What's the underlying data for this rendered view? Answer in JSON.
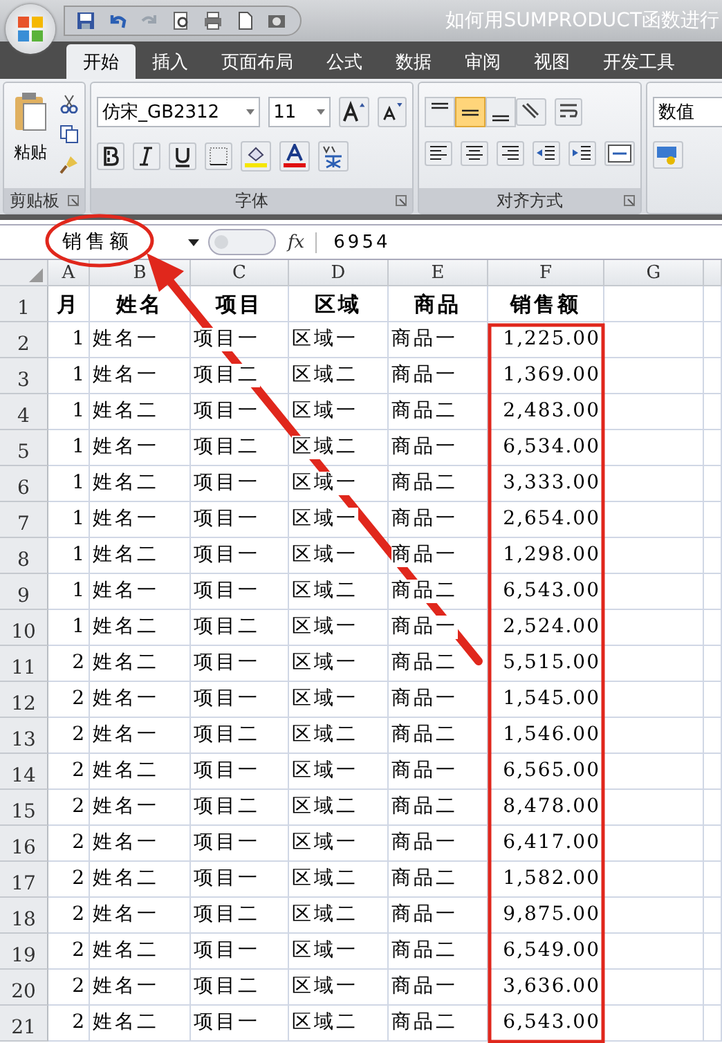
{
  "window": {
    "title": "如何用SUMPRODUCT函数进行"
  },
  "tabs": [
    {
      "label": "开始",
      "selected": true
    },
    {
      "label": "插入",
      "selected": false
    },
    {
      "label": "页面布局",
      "selected": false
    },
    {
      "label": "公式",
      "selected": false
    },
    {
      "label": "数据",
      "selected": false
    },
    {
      "label": "审阅",
      "selected": false
    },
    {
      "label": "视图",
      "selected": false
    },
    {
      "label": "开发工具",
      "selected": false
    }
  ],
  "ribbon": {
    "clipboard": {
      "paste_label": "粘贴",
      "group_label": "剪贴板"
    },
    "font": {
      "font_name": "仿宋_GB2312",
      "font_size": "11",
      "group_label": "字体"
    },
    "alignment": {
      "vertical_align": [
        {
          "selected": false
        },
        {
          "selected": true
        },
        {
          "selected": false
        }
      ],
      "group_label": "对齐方式"
    },
    "number": {
      "format": "数值"
    }
  },
  "formula_bar": {
    "name_box": "销售额",
    "function_label": "fx",
    "formula": "6954"
  },
  "sheet": {
    "columns": [
      "A",
      "B",
      "C",
      "D",
      "E",
      "F",
      "G"
    ],
    "header_row": {
      "row_number": "1",
      "cells": [
        "月",
        "姓名",
        "项目",
        "区域",
        "商品",
        "销售额"
      ]
    },
    "rows": [
      {
        "row_number": "2",
        "cells": [
          "1",
          "姓名一",
          "项目一",
          "区域一",
          "商品一",
          "1,225.00"
        ]
      },
      {
        "row_number": "3",
        "cells": [
          "1",
          "姓名一",
          "项目二",
          "区域二",
          "商品一",
          "1,369.00"
        ]
      },
      {
        "row_number": "4",
        "cells": [
          "1",
          "姓名二",
          "项目一",
          "区域一",
          "商品二",
          "2,483.00"
        ]
      },
      {
        "row_number": "5",
        "cells": [
          "1",
          "姓名一",
          "项目二",
          "区域二",
          "商品一",
          "6,534.00"
        ]
      },
      {
        "row_number": "6",
        "cells": [
          "1",
          "姓名二",
          "项目一",
          "区域一",
          "商品二",
          "3,333.00"
        ]
      },
      {
        "row_number": "7",
        "cells": [
          "1",
          "姓名一",
          "项目一",
          "区域一",
          "商品一",
          "2,654.00"
        ]
      },
      {
        "row_number": "8",
        "cells": [
          "1",
          "姓名二",
          "项目一",
          "区域一",
          "商品一",
          "1,298.00"
        ]
      },
      {
        "row_number": "9",
        "cells": [
          "1",
          "姓名一",
          "项目一",
          "区域二",
          "商品二",
          "6,543.00"
        ]
      },
      {
        "row_number": "10",
        "cells": [
          "1",
          "姓名二",
          "项目二",
          "区域一",
          "商品一",
          "2,524.00"
        ]
      },
      {
        "row_number": "11",
        "cells": [
          "2",
          "姓名二",
          "项目一",
          "区域一",
          "商品二",
          "5,515.00"
        ]
      },
      {
        "row_number": "12",
        "cells": [
          "2",
          "姓名一",
          "项目一",
          "区域一",
          "商品一",
          "1,545.00"
        ]
      },
      {
        "row_number": "13",
        "cells": [
          "2",
          "姓名一",
          "项目二",
          "区域二",
          "商品二",
          "1,546.00"
        ]
      },
      {
        "row_number": "14",
        "cells": [
          "2",
          "姓名二",
          "项目一",
          "区域一",
          "商品一",
          "6,565.00"
        ]
      },
      {
        "row_number": "15",
        "cells": [
          "2",
          "姓名一",
          "项目二",
          "区域二",
          "商品二",
          "8,478.00"
        ]
      },
      {
        "row_number": "16",
        "cells": [
          "2",
          "姓名一",
          "项目一",
          "区域一",
          "商品一",
          "6,417.00"
        ]
      },
      {
        "row_number": "17",
        "cells": [
          "2",
          "姓名二",
          "项目一",
          "区域二",
          "商品二",
          "1,582.00"
        ]
      },
      {
        "row_number": "18",
        "cells": [
          "2",
          "姓名一",
          "项目二",
          "区域二",
          "商品一",
          "9,875.00"
        ]
      },
      {
        "row_number": "19",
        "cells": [
          "2",
          "姓名二",
          "项目一",
          "区域一",
          "商品二",
          "6,549.00"
        ]
      },
      {
        "row_number": "20",
        "cells": [
          "2",
          "姓名一",
          "项目二",
          "区域一",
          "商品一",
          "3,636.00"
        ]
      },
      {
        "row_number": "21",
        "cells": [
          "2",
          "姓名二",
          "项目一",
          "区域二",
          "商品二",
          "6,543.00"
        ]
      }
    ]
  }
}
